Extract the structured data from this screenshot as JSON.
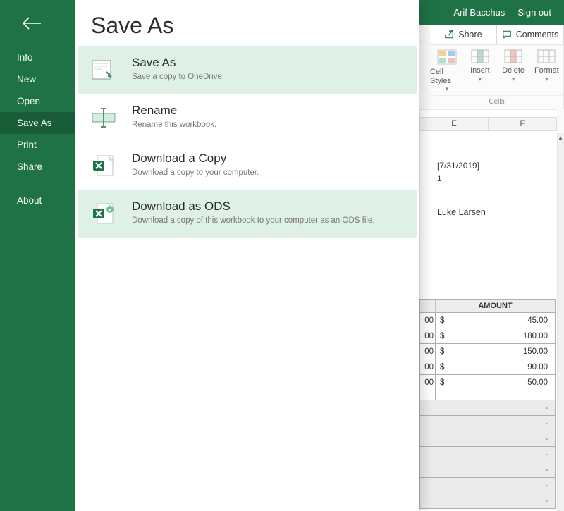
{
  "header": {
    "user": "Arif Bacchus",
    "signout": "Sign out"
  },
  "ribbon": {
    "share": "Share",
    "comments": "Comments",
    "cell_styles": "Cell Styles",
    "insert": "Insert",
    "delete": "Delete",
    "format": "Format",
    "group": "Cells"
  },
  "columns": {
    "E": "E",
    "F": "F"
  },
  "clip": {
    "date": "[7/31/2019]",
    "one": "1",
    "name": "Luke Larsen"
  },
  "amount": {
    "header": "AMOUNT",
    "currency": "$",
    "rows": [
      {
        "trail": "00",
        "value": "45.00"
      },
      {
        "trail": "00",
        "value": "180.00"
      },
      {
        "trail": "00",
        "value": "150.00"
      },
      {
        "trail": "00",
        "value": "90.00"
      },
      {
        "trail": "00",
        "value": "50.00"
      }
    ],
    "dashes": [
      "-",
      "-",
      "-",
      "-",
      "-",
      "-",
      "-"
    ]
  },
  "backstage": {
    "title": "Save As",
    "nav": {
      "info": "Info",
      "new": "New",
      "open": "Open",
      "saveas": "Save As",
      "print": "Print",
      "share": "Share",
      "about": "About"
    },
    "options": {
      "saveas": {
        "title": "Save As",
        "desc": "Save a copy to OneDrive."
      },
      "rename": {
        "title": "Rename",
        "desc": "Rename this workbook."
      },
      "download": {
        "title": "Download a Copy",
        "desc": "Download a copy to your computer."
      },
      "ods": {
        "title": "Download as ODS",
        "desc": "Download a copy of this workbook to your computer as an ODS file."
      }
    }
  }
}
